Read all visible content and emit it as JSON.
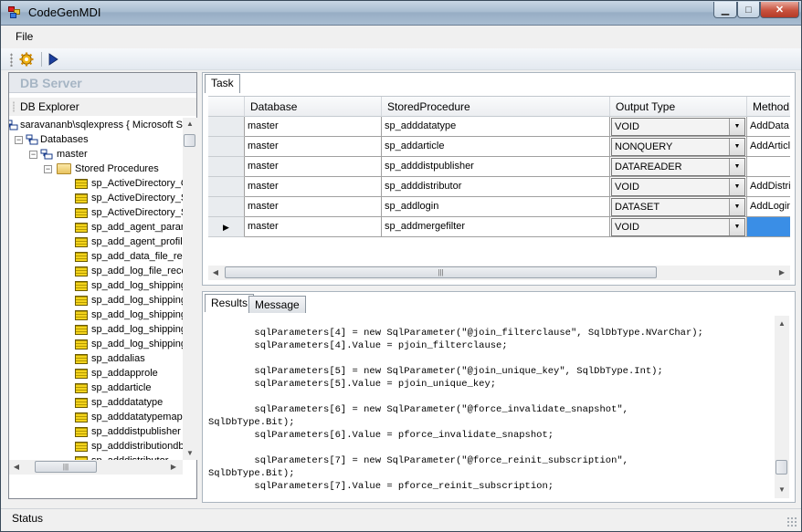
{
  "window": {
    "title": "CodeGenMDI"
  },
  "menu": {
    "file": "File"
  },
  "left_panel": {
    "header": "DB Server",
    "explorer_label": "DB Explorer",
    "tree": {
      "server": "saravananb\\sqlexpress { Microsoft S",
      "databases": "Databases",
      "master": "master",
      "stored_procedures": "Stored Procedures",
      "procs": [
        "sp_ActiveDirectory_O",
        "sp_ActiveDirectory_S",
        "sp_ActiveDirectory_S",
        "sp_add_agent_param",
        "sp_add_agent_profile",
        "sp_add_data_file_rec",
        "sp_add_log_file_reco",
        "sp_add_log_shipping",
        "sp_add_log_shipping",
        "sp_add_log_shipping",
        "sp_add_log_shipping",
        "sp_add_log_shipping",
        "sp_addalias",
        "sp_addapprole",
        "sp_addarticle",
        "sp_adddatatype",
        "sp_adddatatypemapp",
        "sp_adddistpublisher",
        "sp_adddistributiondb",
        "sp_adddistributor"
      ]
    }
  },
  "task_panel": {
    "tab": "Task",
    "columns": [
      "Database",
      "StoredProcedure",
      "Output Type",
      "Method"
    ],
    "rows": [
      {
        "database": "master",
        "proc": "sp_adddatatype",
        "output": "VOID",
        "method": "AddData",
        "current": false
      },
      {
        "database": "master",
        "proc": "sp_addarticle",
        "output": "NONQUERY",
        "method": "AddArticl",
        "current": false
      },
      {
        "database": "master",
        "proc": "sp_adddistpublisher",
        "output": "DATAREADER",
        "method": "",
        "current": false
      },
      {
        "database": "master",
        "proc": "sp_adddistributor",
        "output": "VOID",
        "method": "AddDistri",
        "current": false
      },
      {
        "database": "master",
        "proc": "sp_addlogin",
        "output": "DATASET",
        "method": "AddLogin",
        "current": false
      },
      {
        "database": "master",
        "proc": "sp_addmergefilter",
        "output": "VOID",
        "method": "",
        "current": true
      }
    ]
  },
  "results_panel": {
    "tabs": [
      "Results",
      "Message"
    ],
    "code_lines": [
      "",
      "        sqlParameters[4] = new SqlParameter(\"@join_filterclause\", SqlDbType.NVarChar);",
      "        sqlParameters[4].Value = pjoin_filterclause;",
      "",
      "        sqlParameters[5] = new SqlParameter(\"@join_unique_key\", SqlDbType.Int);",
      "        sqlParameters[5].Value = pjoin_unique_key;",
      "",
      "        sqlParameters[6] = new SqlParameter(\"@force_invalidate_snapshot\",",
      "SqlDbType.Bit);",
      "        sqlParameters[6].Value = pforce_invalidate_snapshot;",
      "",
      "        sqlParameters[7] = new SqlParameter(\"@force_reinit_subscription\",",
      "SqlDbType.Bit);",
      "        sqlParameters[7].Value = pforce_reinit_subscription;"
    ]
  },
  "status": {
    "text": "Status"
  },
  "icons": {
    "settings": "gear-icon",
    "run": "play-icon"
  }
}
